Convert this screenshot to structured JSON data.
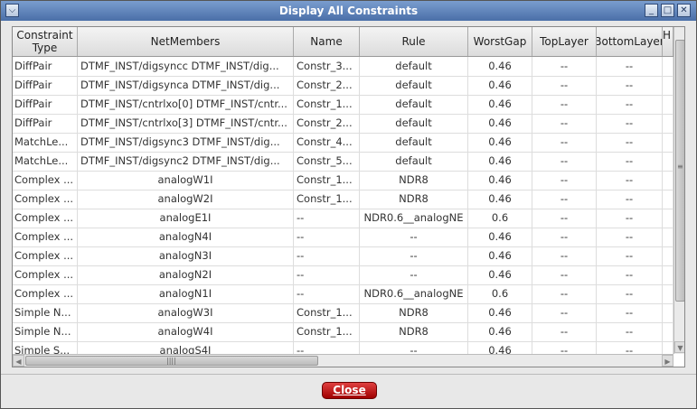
{
  "window": {
    "title": "Display All Constraints",
    "controls": [
      "chevron-down-icon",
      "minimize-icon",
      "maximize-icon",
      "close-icon"
    ]
  },
  "table": {
    "columns": [
      "Constraint Type",
      "NetMembers",
      "Name",
      "Rule",
      "WorstGap",
      "TopLayer",
      "BottomLayer",
      "H"
    ],
    "rows": [
      [
        "DiffPair",
        "DTMF_INST/digsyncc DTMF_INST/dig...",
        "Constr_3...",
        "default",
        "0.46",
        "--",
        "--"
      ],
      [
        "DiffPair",
        "DTMF_INST/digsynca DTMF_INST/dig...",
        "Constr_2...",
        "default",
        "0.46",
        "--",
        "--"
      ],
      [
        "DiffPair",
        "DTMF_INST/cntrlxo[0] DTMF_INST/cntr...",
        "Constr_1...",
        "default",
        "0.46",
        "--",
        "--"
      ],
      [
        "DiffPair",
        "DTMF_INST/cntrlxo[3] DTMF_INST/cntr...",
        "Constr_2...",
        "default",
        "0.46",
        "--",
        "--"
      ],
      [
        "MatchLe...",
        "DTMF_INST/digsync3 DTMF_INST/dig...",
        "Constr_4...",
        "default",
        "0.46",
        "--",
        "--"
      ],
      [
        "MatchLe...",
        "DTMF_INST/digsync2 DTMF_INST/dig...",
        "Constr_5...",
        "default",
        "0.46",
        "--",
        "--"
      ],
      [
        "Complex ...",
        "analogW1I",
        "Constr_1...",
        "NDR8",
        "0.46",
        "--",
        "--"
      ],
      [
        "Complex ...",
        "analogW2I",
        "Constr_1...",
        "NDR8",
        "0.46",
        "--",
        "--"
      ],
      [
        "Complex ...",
        "analogE1I",
        "--",
        "NDR0.6__analogNE",
        "0.6",
        "--",
        "--"
      ],
      [
        "Complex ...",
        "analogN4I",
        "--",
        "--",
        "0.46",
        "--",
        "--"
      ],
      [
        "Complex ...",
        "analogN3I",
        "--",
        "--",
        "0.46",
        "--",
        "--"
      ],
      [
        "Complex ...",
        "analogN2I",
        "--",
        "--",
        "0.46",
        "--",
        "--"
      ],
      [
        "Complex ...",
        "analogN1I",
        "--",
        "NDR0.6__analogNE",
        "0.6",
        "--",
        "--"
      ],
      [
        "Simple N...",
        "analogW3I",
        "Constr_1...",
        "NDR8",
        "0.46",
        "--",
        "--"
      ],
      [
        "Simple N...",
        "analogW4I",
        "Constr_1...",
        "NDR8",
        "0.46",
        "--",
        "--"
      ],
      [
        "Simple S...",
        "analogS4I",
        "--",
        "--",
        "0.46",
        "--",
        "--"
      ]
    ]
  },
  "scroll": {
    "vertical_grip": "≡",
    "horizontal_grip": "||||"
  },
  "footer": {
    "close_label": "Close"
  },
  "colors": {
    "title_bar": "#4a6fa8",
    "close_button": "#b00000"
  }
}
